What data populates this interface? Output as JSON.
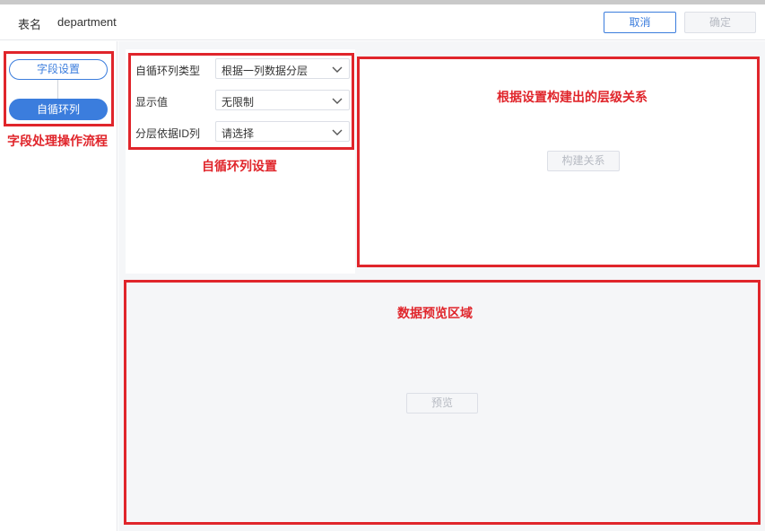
{
  "header": {
    "table_label": "表名",
    "table_value": "department",
    "cancel_label": "取消",
    "confirm_label": "确定"
  },
  "sidebar": {
    "steps": [
      {
        "label": "字段设置",
        "state": "outlined"
      },
      {
        "label": "自循环列",
        "state": "active"
      }
    ]
  },
  "config": {
    "fields": [
      {
        "label": "自循环列类型",
        "value": "根据一列数据分层"
      },
      {
        "label": "显示值",
        "value": "无限制"
      },
      {
        "label": "分层依据ID列",
        "value": "请选择"
      }
    ]
  },
  "relation": {
    "build_label": "构建关系"
  },
  "preview": {
    "preview_label": "预览"
  },
  "annotations": {
    "flow": "字段处理操作流程",
    "config": "自循环列设置",
    "relation": "根据设置构建出的层级关系",
    "preview": "数据预览区域"
  },
  "colors": {
    "accent": "#3b7ddd",
    "annotation_red": "#e0252b",
    "panel_bg": "#f5f6f8",
    "disabled_text": "#b6bac2"
  },
  "icons": {
    "select_arrow": "chevron-down-icon"
  }
}
